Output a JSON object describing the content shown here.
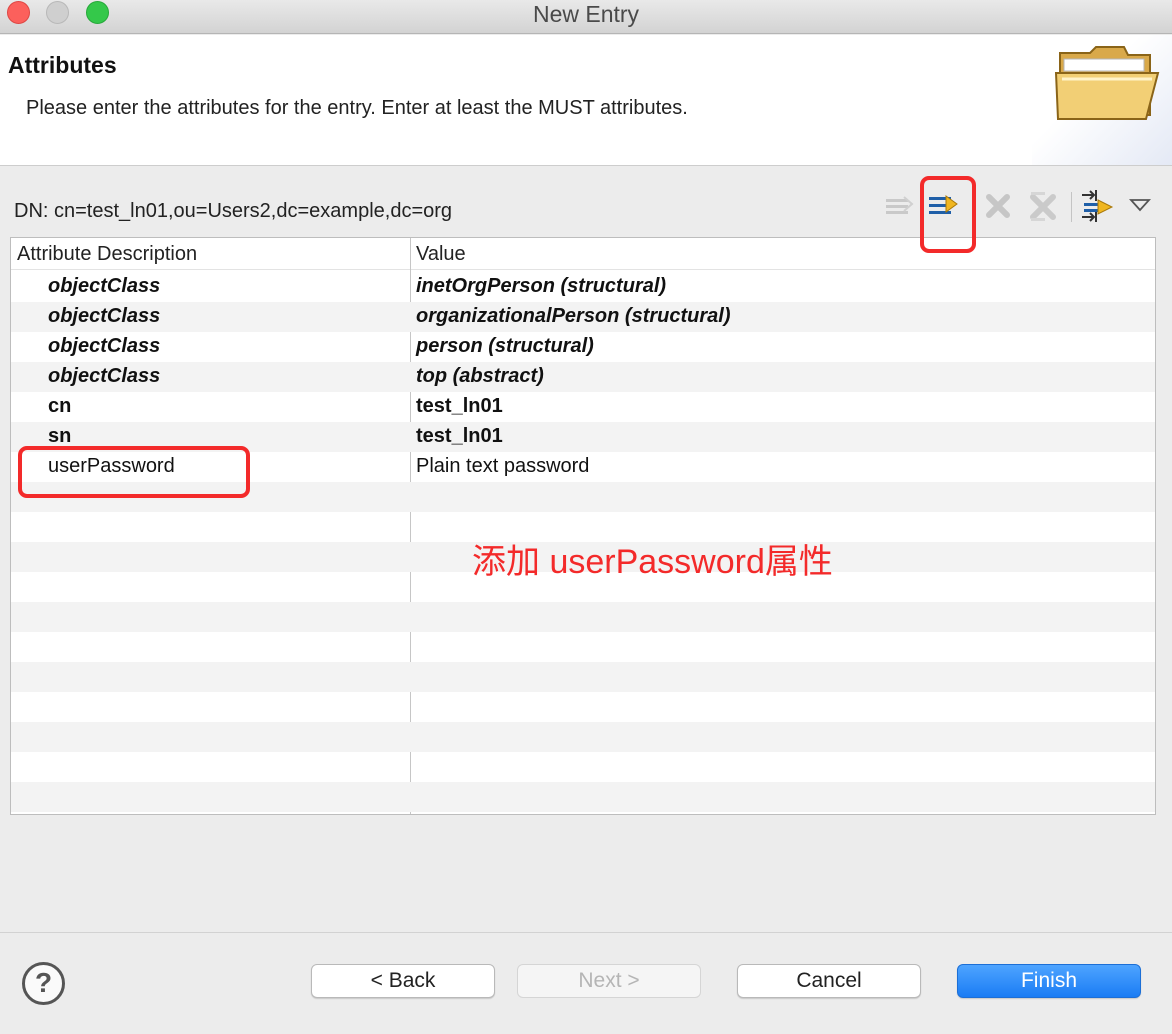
{
  "window": {
    "title": "New Entry"
  },
  "header": {
    "title": "Attributes",
    "description": "Please enter the attributes for the entry. Enter at least the MUST attributes."
  },
  "dn_label": "DN: cn=test_ln01,ou=Users2,dc=example,dc=org",
  "table": {
    "columns": [
      "Attribute Description",
      "Value"
    ],
    "rows": [
      {
        "attribute": "objectClass",
        "value": "inetOrgPerson (structural)"
      },
      {
        "attribute": "objectClass",
        "value": "organizationalPerson (structural)"
      },
      {
        "attribute": "objectClass",
        "value": "person (structural)"
      },
      {
        "attribute": "objectClass",
        "value": "top (abstract)"
      },
      {
        "attribute": "cn",
        "value": "test_ln01"
      },
      {
        "attribute": "sn",
        "value": "test_ln01"
      },
      {
        "attribute": "userPassword",
        "value": "Plain text password"
      }
    ]
  },
  "annotation": "添加 userPassword属性",
  "buttons": {
    "back": "< Back",
    "next": "Next >",
    "cancel": "Cancel",
    "finish": "Finish"
  },
  "help_icon": "?",
  "colors": {
    "annotation_red": "#f32a2a",
    "primary_blue": "#1a7cf4"
  },
  "toolbar_icons": [
    "new-value-icon",
    "new-attribute-icon",
    "delete-icon",
    "delete-all-icon",
    "expand-icon",
    "view-menu-icon"
  ]
}
